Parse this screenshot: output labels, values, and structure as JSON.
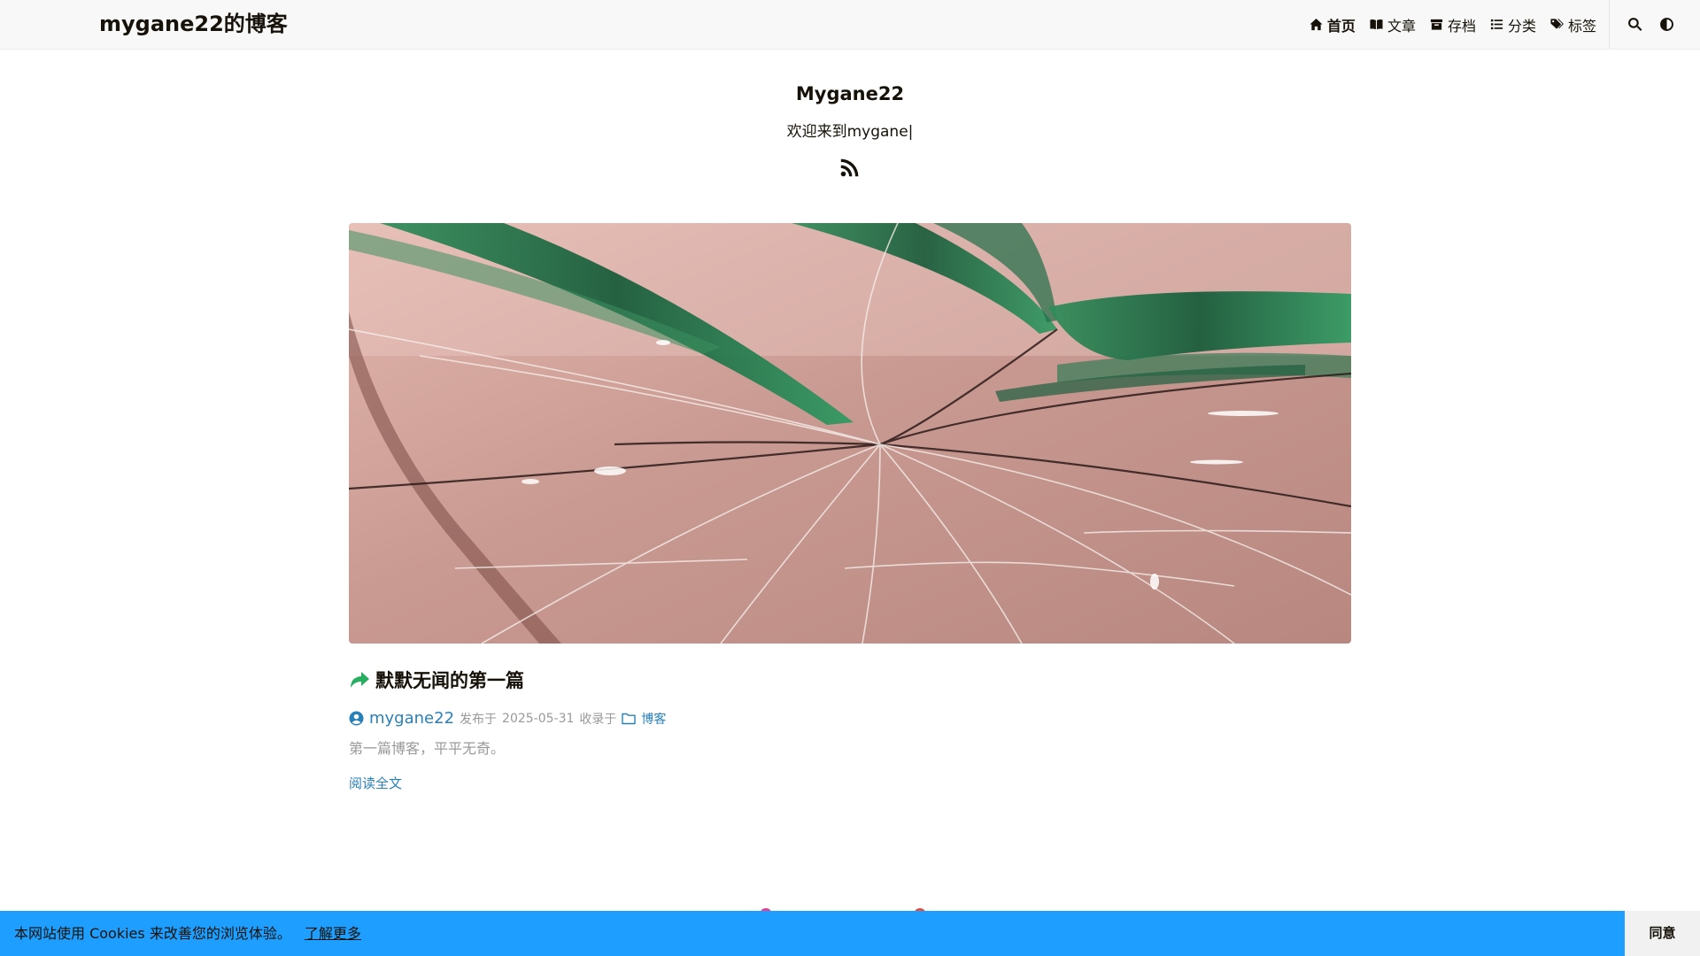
{
  "header": {
    "brand": "mygane22的博客",
    "menu": [
      {
        "label": "首页",
        "icon": "home-icon",
        "active": true
      },
      {
        "label": "文章",
        "icon": "book-icon",
        "active": false
      },
      {
        "label": "存档",
        "icon": "archive-icon",
        "active": false
      },
      {
        "label": "分类",
        "icon": "list-icon",
        "active": false
      },
      {
        "label": "标签",
        "icon": "tags-icon",
        "active": false
      }
    ],
    "tools": [
      {
        "icon": "search-icon"
      },
      {
        "icon": "theme-toggle-icon"
      }
    ]
  },
  "profile": {
    "title": "Mygane22",
    "subtitle": "欢迎来到mygane|",
    "rss_icon": "rss-icon"
  },
  "post": {
    "title": "默默无闻的第一篇",
    "pin_icon": "share-arrow-icon",
    "author": "mygane22",
    "published_prefix": "发布于",
    "date": "2025-05-31",
    "category_prefix": "收录于",
    "category": "博客",
    "summary": "第一篇博客，平平无奇。",
    "read_more": "阅读全文",
    "image_description_icon": "cracked-glass-image"
  },
  "cookie": {
    "message": "本网站使用 Cookies 来改善您的浏览体验。",
    "learn_more": "了解更多",
    "accept": "同意"
  },
  "colors": {
    "accent": "#1e9fff",
    "link": "#2980b9",
    "pin": "#27ae60",
    "text": "#161209",
    "muted": "#999999"
  }
}
